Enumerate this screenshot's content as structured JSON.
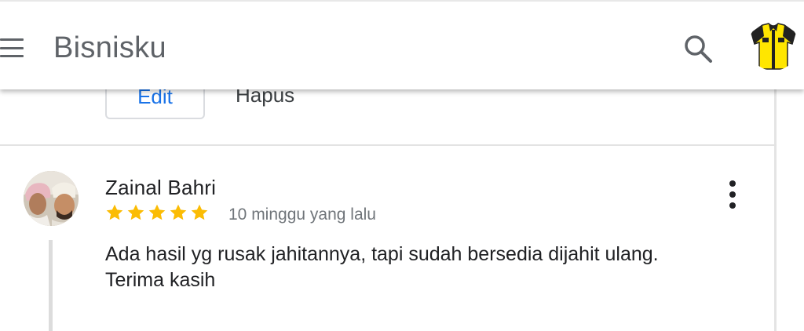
{
  "header": {
    "title": "Bisnisku",
    "menu_icon": "hamburger-menu-icon",
    "search_icon": "search-icon",
    "profile_icon": "yellow-shirt-avatar"
  },
  "reply_actions": {
    "edit_label": "Edit",
    "delete_label": "Hapus"
  },
  "review": {
    "reviewer_name": "Zainal Bahri",
    "rating": 5,
    "rating_max": 5,
    "time_ago": "10 minggu yang lalu",
    "text": "Ada hasil yg rusak jahitannya, tapi sudah bersedia dijahit ulang. Terima kasih",
    "more_icon": "more-vert-icon"
  },
  "colors": {
    "star": "#fbbc04",
    "edit_text": "#1a73e8",
    "title_text": "#5f6368",
    "profile_shirt": "#ffe600"
  }
}
